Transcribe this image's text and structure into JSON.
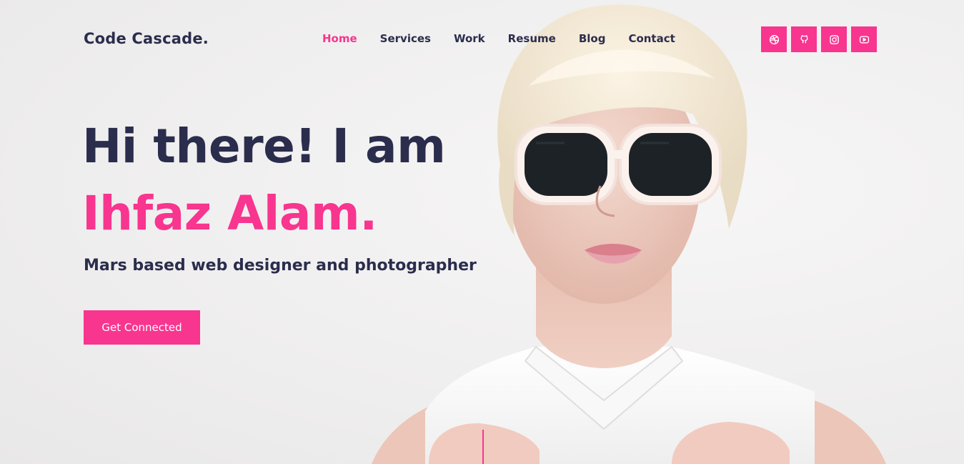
{
  "brand": {
    "logo_text": "Code Cascade."
  },
  "nav": {
    "items": [
      {
        "label": "Home",
        "active": true
      },
      {
        "label": "Services",
        "active": false
      },
      {
        "label": "Work",
        "active": false
      },
      {
        "label": "Resume",
        "active": false
      },
      {
        "label": "Blog",
        "active": false
      },
      {
        "label": "Contact",
        "active": false
      }
    ]
  },
  "socials": [
    {
      "icon": "dribbble-icon"
    },
    {
      "icon": "github-icon"
    },
    {
      "icon": "instagram-icon"
    },
    {
      "icon": "youtube-icon"
    }
  ],
  "hero": {
    "greeting": "Hi there! I am",
    "name": "Ihfaz Alam.",
    "tagline": "Mars based web designer and photographer",
    "cta_label": "Get Connected",
    "image": "portrait-photo"
  },
  "colors": {
    "accent": "#f8358f",
    "text_dark": "#2b2d4d",
    "background": "#f1f0f0"
  }
}
